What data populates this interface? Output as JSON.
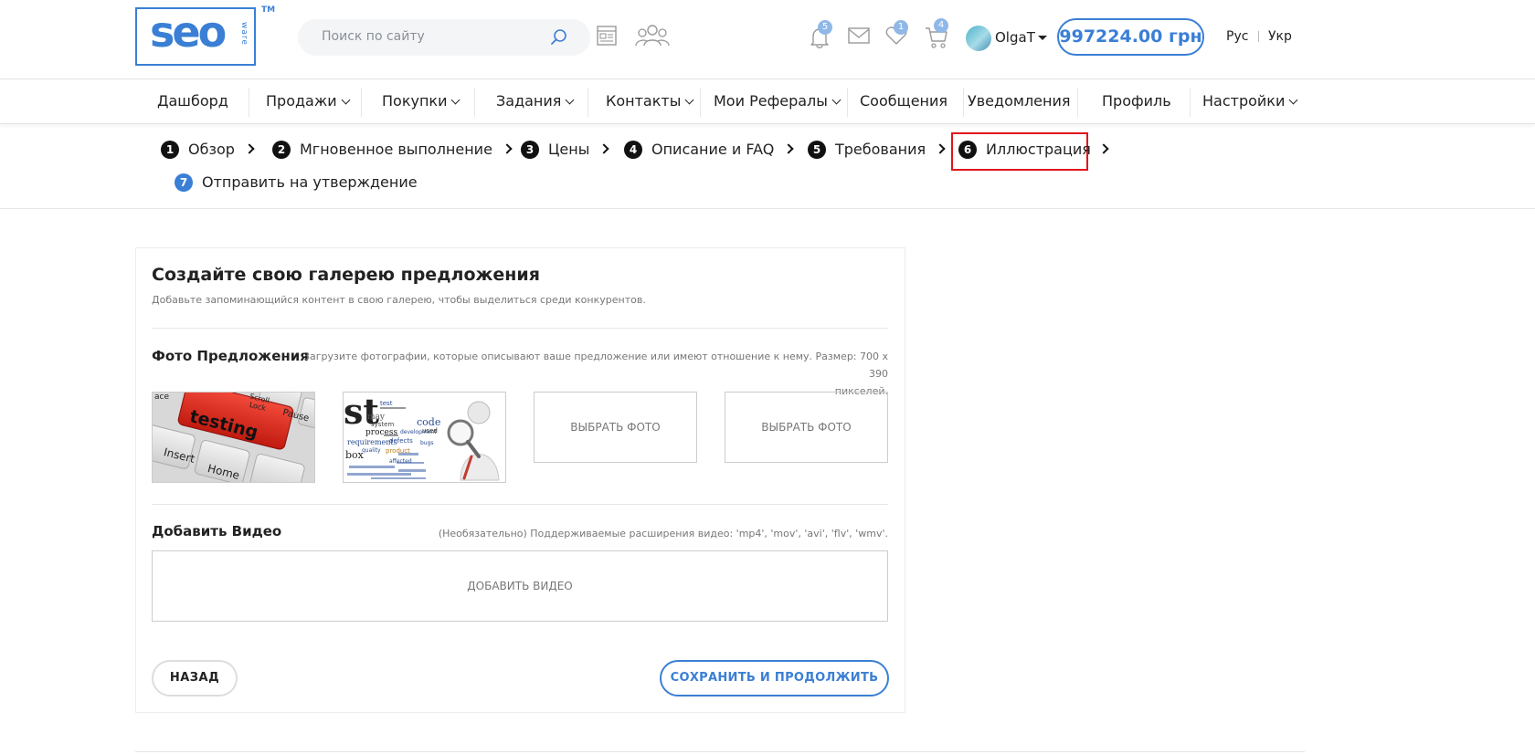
{
  "header": {
    "logo_text": "seo",
    "logo_sub": "ware",
    "logo_tm": "TM",
    "search_placeholder": "Поиск по сайту",
    "notifications_badge": "5",
    "favorites_badge": "1",
    "cart_badge": "4",
    "user_name": "OlgaT",
    "balance": "997224.00 грн",
    "lang_ru": "Рус",
    "lang_uk": "Укр"
  },
  "nav": {
    "items": [
      {
        "label": "Дашборд",
        "dropdown": false
      },
      {
        "label": "Продажи",
        "dropdown": true
      },
      {
        "label": "Покупки",
        "dropdown": true
      },
      {
        "label": "Задания",
        "dropdown": true
      },
      {
        "label": "Контакты",
        "dropdown": true
      },
      {
        "label": "Мои Рефералы",
        "dropdown": true
      },
      {
        "label": "Сообщения",
        "dropdown": false
      },
      {
        "label": "Уведомления",
        "dropdown": false
      },
      {
        "label": "Профиль",
        "dropdown": false
      },
      {
        "label": "Настройки",
        "dropdown": true
      }
    ]
  },
  "steps": [
    {
      "num": "1",
      "label": "Обзор"
    },
    {
      "num": "2",
      "label": "Мгновенное выполнение"
    },
    {
      "num": "3",
      "label": "Цены"
    },
    {
      "num": "4",
      "label": "Описание и FAQ"
    },
    {
      "num": "5",
      "label": "Требования"
    },
    {
      "num": "6",
      "label": "Иллюстрация",
      "active": true
    },
    {
      "num": "7",
      "label": "Отправить на утверждение"
    }
  ],
  "card": {
    "title": "Создайте свою галерею предложения",
    "subtitle": "Добавьте запоминающийся контент в свою галерею, чтобы выделиться среди конкурентов.",
    "photos": {
      "title": "Фото Предложения",
      "hint_line1": "Загрузите фотографии, которые описывают ваше предложение или имеют отношение к нему. Размер: 700 x 390",
      "hint_line2": "пикселей.",
      "thumb1_text": "testing",
      "thumb1_key_esc": "ace",
      "thumb1_key_scroll": "Scroll Lock",
      "thumb1_key_pause": "Pause",
      "thumb1_key_insert": "Insert",
      "thumb1_key_home": "Home",
      "thumb2_big": "st",
      "thumb2_words": [
        "test",
        "code",
        "may",
        "system",
        "process",
        "development",
        "requirements",
        "defects",
        "quality",
        "product",
        "bugs",
        "box",
        "used",
        "affected"
      ],
      "slot_label": "ВЫБРАТЬ ФОТО"
    },
    "video": {
      "title": "Добавить Видео",
      "hint": "(Необязательно) Поддерживаемые расширения видео: 'mp4', 'mov', 'avi', 'flv', 'wmv'.",
      "box_label": "ДОБАВИТЬ ВИДЕО"
    },
    "back_label": "НАЗАД",
    "save_label": "СОХРАНИТЬ И ПРОДОЛЖИТЬ"
  },
  "colors": {
    "accent": "#3a7fd5",
    "active_step_border": "#e0161c",
    "badge": "#8fb8e8"
  }
}
